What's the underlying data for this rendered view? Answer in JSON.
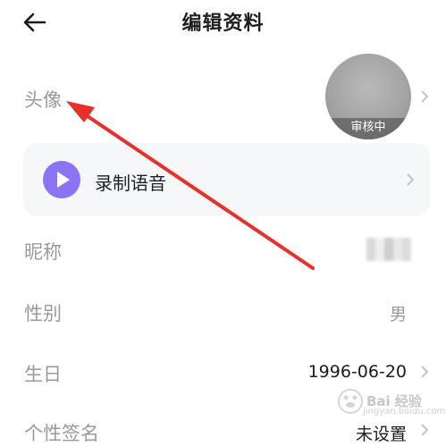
{
  "header": {
    "title": "编辑资料"
  },
  "avatar_row": {
    "label": "头像",
    "badge": "审核中"
  },
  "voice": {
    "label": "录制语音"
  },
  "nickname_row": {
    "label": "昵称"
  },
  "gender_row": {
    "label": "性别",
    "value": "男"
  },
  "birthday_row": {
    "label": "生日",
    "value": "1996-06-20"
  },
  "signature_row": {
    "label": "个性签名",
    "value": "未设置"
  },
  "watermark": {
    "text": "Bai 经验",
    "url": "jingyan.baidu.com"
  },
  "colors": {
    "accent_purple": "#8b73f5",
    "annotation_red": "#e8302a",
    "label_gray": "#9a9a9a"
  },
  "icons": [
    "back-arrow-icon",
    "chevron-right-icon",
    "play-icon",
    "annotation-arrow"
  ]
}
